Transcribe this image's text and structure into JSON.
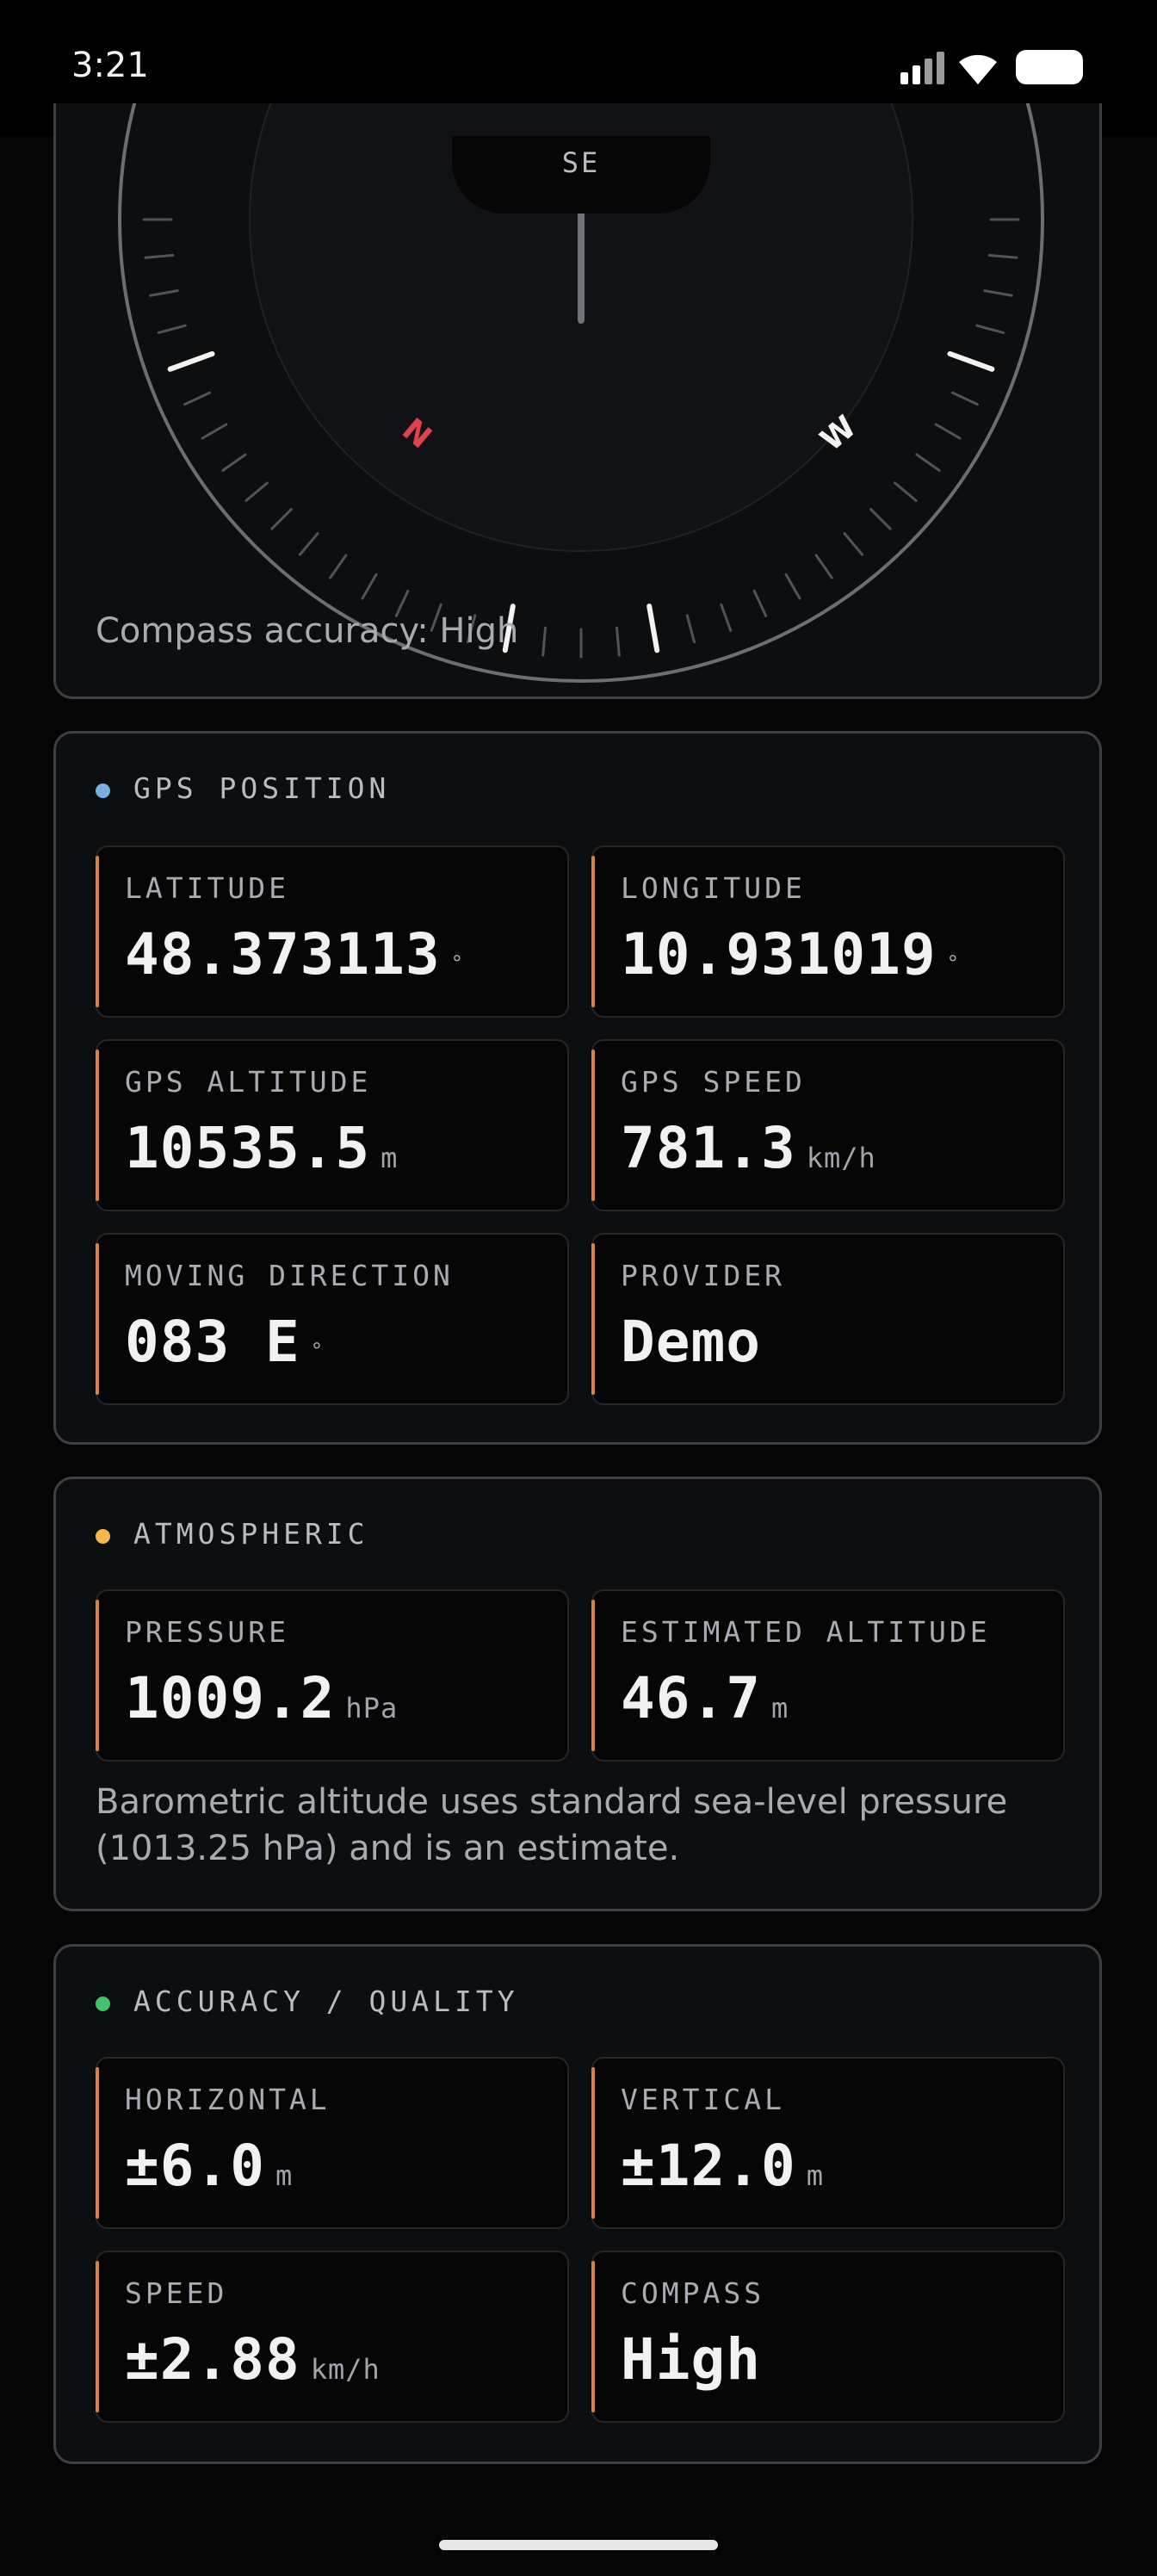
{
  "status_bar": {
    "time": "3:21"
  },
  "compass": {
    "heading_label": "SE",
    "cardinal_n": "N",
    "cardinal_w": "W",
    "accuracy_text": "Compass accuracy: High",
    "north_color": "#e0414a"
  },
  "gps": {
    "title": "GPS POSITION",
    "dot_color": "#7aaede",
    "tiles": [
      {
        "label": "LATITUDE",
        "value": "48.373113",
        "unit": "°"
      },
      {
        "label": "LONGITUDE",
        "value": "10.931019",
        "unit": "°"
      },
      {
        "label": "GPS ALTITUDE",
        "value": "10535.5",
        "unit": "m"
      },
      {
        "label": "GPS SPEED",
        "value": "781.3",
        "unit": "km/h"
      },
      {
        "label": "MOVING DIRECTION",
        "value": "083 E",
        "unit": "°"
      },
      {
        "label": "PROVIDER",
        "value": "Demo",
        "unit": ""
      }
    ]
  },
  "atmospheric": {
    "title": "ATMOSPHERIC",
    "dot_color": "#f0b94a",
    "tiles": [
      {
        "label": "PRESSURE",
        "value": "1009.2",
        "unit": "hPa"
      },
      {
        "label": "ESTIMATED ALTITUDE",
        "value": "46.7",
        "unit": "m"
      }
    ],
    "note": "Barometric altitude uses standard sea-level pressure (1013.25 hPa) and is an estimate."
  },
  "accuracy": {
    "title": "ACCURACY / QUALITY",
    "dot_color": "#3fc46b",
    "tiles": [
      {
        "label": "HORIZONTAL",
        "value": "±6.0",
        "unit": "m"
      },
      {
        "label": "VERTICAL",
        "value": "±12.0",
        "unit": "m"
      },
      {
        "label": "SPEED",
        "value": "±2.88",
        "unit": "km/h"
      },
      {
        "label": "COMPASS",
        "value": "High",
        "unit": ""
      }
    ]
  },
  "accent_color": "#d9814a"
}
